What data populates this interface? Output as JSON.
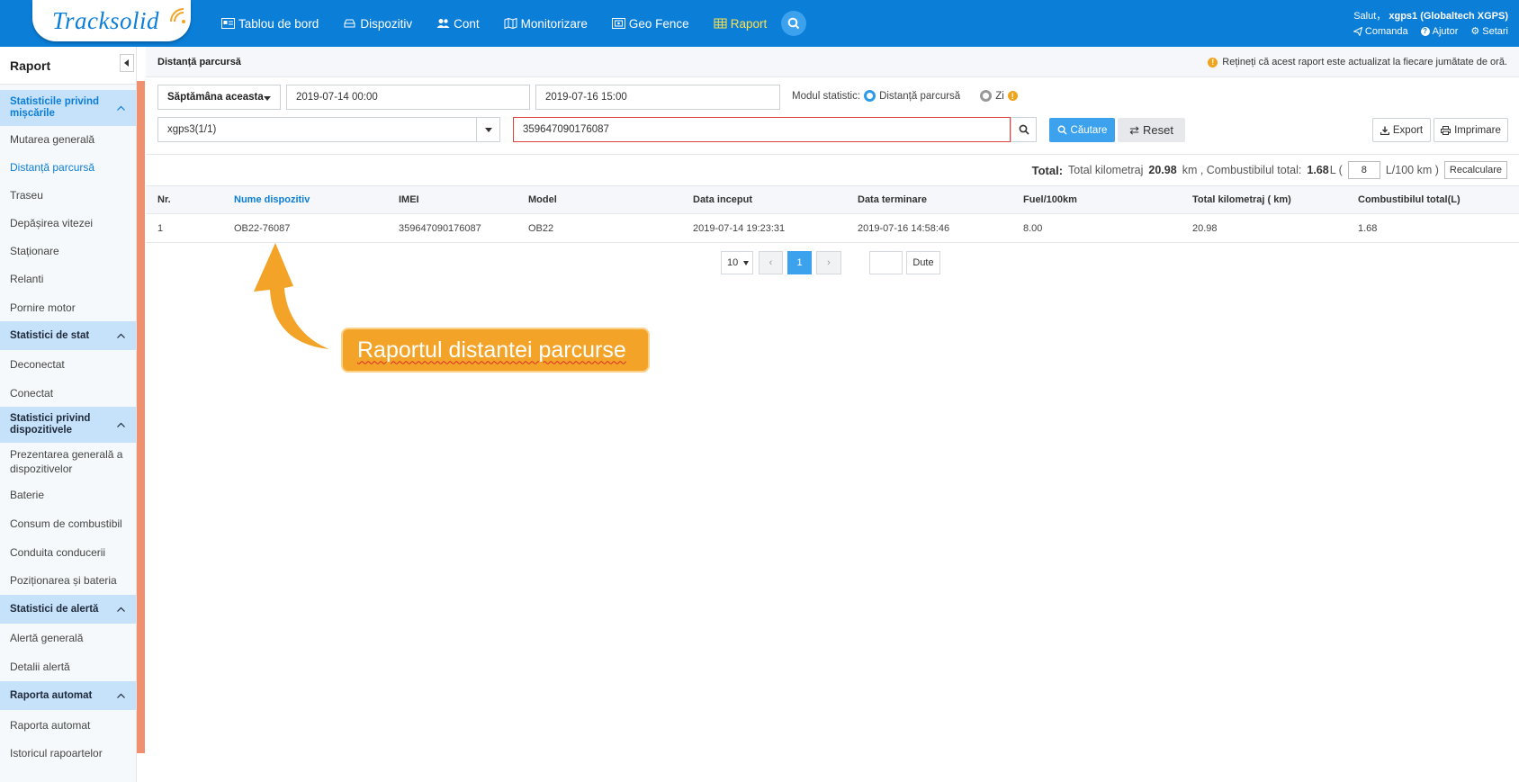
{
  "brand": {
    "name": "Tracksolid"
  },
  "nav": {
    "items": [
      {
        "label": "Tablou de bord",
        "icon": "dashboard-icon"
      },
      {
        "label": "Dispozitiv",
        "icon": "device-icon"
      },
      {
        "label": "Cont",
        "icon": "users-icon"
      },
      {
        "label": "Monitorizare",
        "icon": "map-icon"
      },
      {
        "label": "Geo Fence",
        "icon": "geofence-icon"
      },
      {
        "label": "Raport",
        "icon": "table-icon",
        "active": true
      }
    ],
    "active_color": "#ffe14d"
  },
  "user": {
    "greeting": "Salut，",
    "name": "xgps1 (Globaltech XGPS)",
    "links": [
      "Comanda",
      "Ajutor",
      "Setari"
    ]
  },
  "sidebar": {
    "title": "Raport",
    "sections": [
      {
        "title": "Statisticile privind mișcările",
        "items": [
          "Mutarea generală",
          "Distanță parcursă",
          "Traseu",
          "Depășirea vitezei",
          "Staționare",
          "Relanti",
          "Pornire motor"
        ]
      },
      {
        "title": "Statistici de stat",
        "items": [
          "Deconectat",
          "Conectat"
        ]
      },
      {
        "title": "Statistici privind dispozitivele",
        "items": [
          "Prezentarea generală a dispozitivelor",
          "Baterie",
          "Consum de combustibil",
          "Conduita conducerii",
          "Poziționarea și bateria"
        ]
      },
      {
        "title": "Statistici de alertă",
        "items": [
          "Alertă generală",
          "Detalii alertă"
        ]
      },
      {
        "title": "Raporta automat",
        "items": [
          "Raporta automat",
          "Istoricul rapoartelor"
        ]
      }
    ]
  },
  "main": {
    "title": "Distanță parcursă",
    "note": "Rețineți că acest raport este actualizat la fiecare jumătate de oră."
  },
  "filters": {
    "period": "Săptămâna aceasta",
    "start": "2019-07-14 00:00",
    "end": "2019-07-16 15:00",
    "stat_mode_label": "Modul statistic:",
    "mode_distance": "Distanță parcursă",
    "mode_day": "Zi",
    "account": "xgps3(1/1)",
    "imei": "359647090176087",
    "search_btn": "Căutare",
    "reset_btn": "Reset",
    "export_btn": "Export",
    "print_btn": "Imprimare"
  },
  "totals": {
    "label": "Total:",
    "km_label": "Total kilometraj",
    "km_value": "20.98",
    "km_unit": "km , Combustibilul total:",
    "fuel_value": "1.68",
    "fuel_unit": "L (",
    "fuel_rate": "8",
    "rate_unit": "L/100 km )",
    "recalc_btn": "Recalculare"
  },
  "table": {
    "headers": [
      "Nr.",
      "Nume dispozitiv",
      "IMEI",
      "Model",
      "Data inceput",
      "Data terminare",
      "Fuel/100km",
      "Total kilometraj ( km)",
      "Combustibilul total(L)"
    ],
    "rows": [
      [
        "1",
        "OB22-76087",
        "359647090176087",
        "OB22",
        "2019-07-14 19:23:31",
        "2019-07-16 14:58:46",
        "8.00",
        "20.98",
        "1.68"
      ]
    ]
  },
  "pager": {
    "page_size": "10",
    "prev": "‹",
    "current": "1",
    "next": "›",
    "goto_btn": "Dute"
  },
  "annotation": {
    "callout": "Raportul distantei parcurse"
  },
  "colors": {
    "topbar": "#0b7ed8",
    "accent": "#3ca2ee",
    "section_bg": "#c6e1fa",
    "callout": "#f3a327"
  }
}
